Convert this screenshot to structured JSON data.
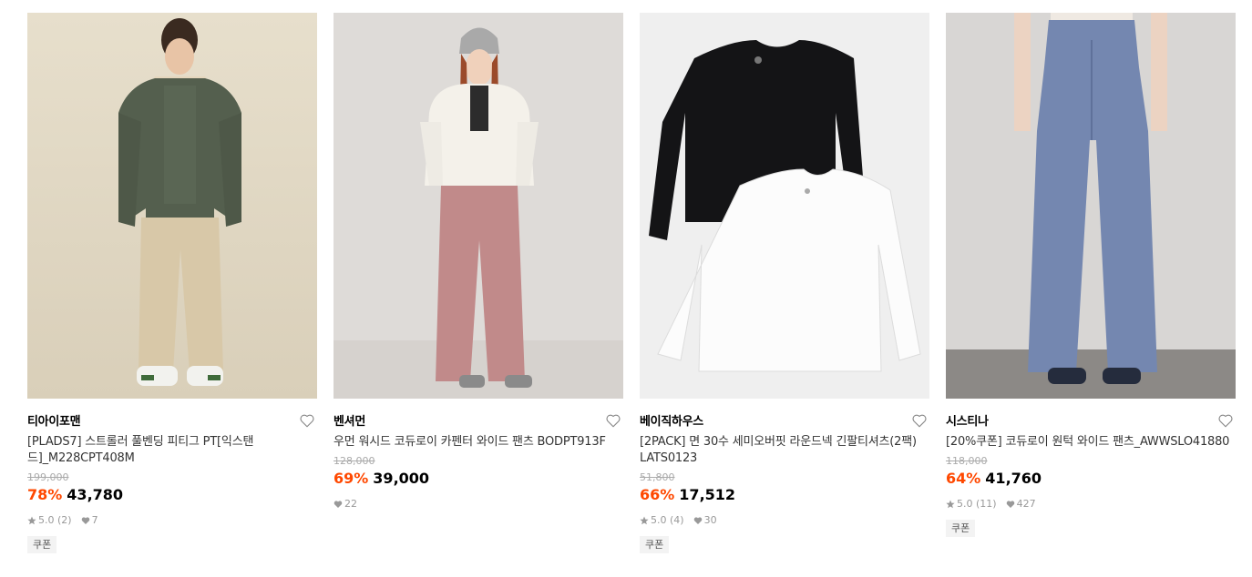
{
  "products": [
    {
      "brand": "티아이포맨",
      "name": "[PLADS7] 스트롤러 풀벤딩 피티그 PT[익스탠드]_M228CPT408M",
      "original_price": "199,000",
      "discount": "78%",
      "price": "43,780",
      "rating": "5.0 (2)",
      "likes": "7",
      "badge": "쿠폰"
    },
    {
      "brand": "벤셔먼",
      "name": "우먼 워시드 코듀로이 카펜터 와이드 팬츠 BODPT913F",
      "original_price": "128,000",
      "discount": "69%",
      "price": "39,000",
      "likes": "22"
    },
    {
      "brand": "베이직하우스",
      "name": "[2PACK] 면 30수 세미오버핏 라운드넥 긴팔티셔츠(2팩) LATS0123",
      "original_price": "51,800",
      "discount": "66%",
      "price": "17,512",
      "rating": "5.0 (4)",
      "likes": "30",
      "badge": "쿠폰"
    },
    {
      "brand": "시스티나",
      "name": "[20%쿠폰] 코듀로이 원턱 와이드 팬츠_AWWSLO41880",
      "original_price": "118,000",
      "discount": "64%",
      "price": "41,760",
      "rating": "5.0 (11)",
      "likes": "427",
      "badge": "쿠폰"
    }
  ],
  "colors": {
    "discount": "#ff4800",
    "muted": "#999999"
  },
  "icons": {
    "wishlist": "heart-outline-icon",
    "rating": "star-icon",
    "likes": "heart-filled-icon"
  }
}
